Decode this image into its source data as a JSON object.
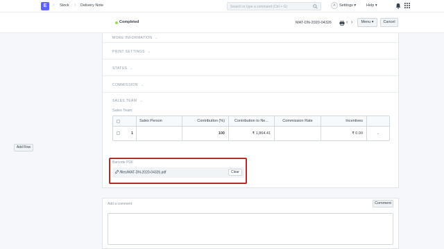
{
  "navbar": {
    "logo_letter": "E",
    "breadcrumbs": [
      "Stock",
      "Delivery Note"
    ],
    "search_placeholder": "Search or type a command (Ctrl + G)",
    "avatar_letter": "A",
    "settings_label": "Settings",
    "help_label": "Help"
  },
  "page_head": {
    "status": "Completed",
    "status_color": "#98d85b",
    "doc_name": "MAT-DN-2020-04326",
    "menu_label": "Menu",
    "cancel_label": "Cancel"
  },
  "form": {
    "sections": {
      "more_info": "MORE INFORMATION",
      "print_settings": "PRINT SETTINGS",
      "status": "STATUS",
      "commission": "COMMISSION",
      "sales_team": "SALES TEAM"
    },
    "sales_team_label": "Sales Team",
    "grid": {
      "headers": {
        "sales_person": "Sales Person",
        "contribution_pct": "Contribution (%)",
        "contribution_net": "Contribution to Ne...",
        "commission_rate": "Commission Rate",
        "incentives": "Incentives"
      },
      "row": {
        "idx": "1",
        "sales_person": "",
        "contribution_pct": "100",
        "contribution_net": "₹ 1,864.41",
        "commission_rate": "",
        "incentives": "₹ 0.00"
      },
      "add_row_label": "Add Row"
    },
    "barcode": {
      "label": "Barcode PDF",
      "file": "/files/MAT-DN-2020-04326.pdf",
      "clear_label": "Clear",
      "highlight_color": "#b22b2b"
    }
  },
  "comments": {
    "label": "Add a comment",
    "button_label": "Comment"
  },
  "icons": [
    "logo-icon",
    "search-icon",
    "bell-icon",
    "grid-icon",
    "print-icon",
    "prev-icon",
    "next-icon",
    "chevron-down-icon",
    "link-icon"
  ]
}
